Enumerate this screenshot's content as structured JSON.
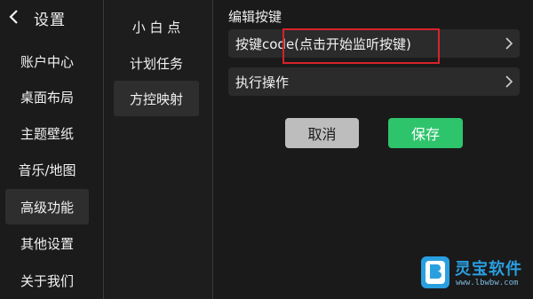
{
  "sidebar": {
    "title": "设置",
    "items": [
      {
        "label": "账户中心"
      },
      {
        "label": "桌面布局"
      },
      {
        "label": "主题壁纸"
      },
      {
        "label": "音乐/地图"
      },
      {
        "label": "高级功能",
        "active": true
      },
      {
        "label": "其他设置"
      },
      {
        "label": "关于我们"
      }
    ]
  },
  "submenu": {
    "items": [
      {
        "label": "小 白 点"
      },
      {
        "label": "计划任务"
      },
      {
        "label": "方控映射",
        "active": true
      }
    ]
  },
  "editor": {
    "title": "编辑按键",
    "key_row_label": "按键code(点击开始监听按键)",
    "action_row_label": "执行操作",
    "cancel_label": "取消",
    "save_label": "保存"
  },
  "watermark": {
    "text": "灵宝软件",
    "url": "www.lbwbw.com"
  },
  "colors": {
    "background": "#1a1a1b",
    "row_background": "#2b2b2c",
    "active_item": "#2e2e2f",
    "cancel_button": "#bdbdbd",
    "save_button": "#2ec46c",
    "highlight_box": "#d8232a",
    "watermark_blue": "#2a9fe0"
  }
}
